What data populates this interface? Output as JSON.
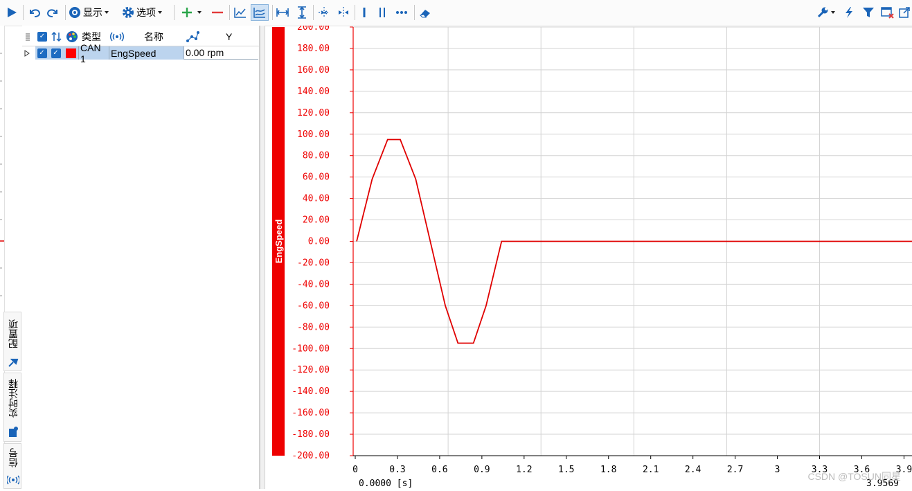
{
  "toolbar": {
    "display_label": "显示",
    "options_label": "选项"
  },
  "icons": [
    "play-icon",
    "undo-icon",
    "redo-icon",
    "display-icon",
    "gear-icon",
    "add-icon",
    "remove-icon",
    "line-chart-icon",
    "multi-line-chart-icon",
    "fit-horizontal-icon",
    "fit-vertical-icon",
    "zoom-in-icon",
    "zoom-out-icon",
    "single-cursor-icon",
    "double-cursor-icon",
    "more-cursor-icon",
    "eraser-icon",
    "wrench-icon",
    "lightning-icon",
    "filter-icon",
    "close-window-icon",
    "popout-icon"
  ],
  "side_tabs": [
    "配置项",
    "实时注释",
    "信号"
  ],
  "signal_table": {
    "columns": [
      "类型",
      "名称",
      "Y"
    ],
    "rows": [
      {
        "type": "CAN 1",
        "name": "EngSpeed",
        "value": "0.00 rpm",
        "color": "#ff0000"
      }
    ]
  },
  "chart_data": {
    "type": "line",
    "series": [
      {
        "name": "EngSpeed",
        "color": "#e00000",
        "x": [
          0.01,
          0.12,
          0.23,
          0.32,
          0.43,
          0.64,
          0.73,
          0.84,
          0.93,
          1.04,
          3.96
        ],
        "y": [
          0,
          58,
          95,
          95,
          58,
          -60,
          -95,
          -95,
          -60,
          0,
          0
        ]
      }
    ],
    "ylabel": "EngSpeed",
    "ylim": [
      -200,
      200
    ],
    "yticks": [
      "200.00",
      "180.00",
      "160.00",
      "140.00",
      "120.00",
      "100.00",
      "80.00",
      "60.00",
      "40.00",
      "20.00",
      "0.00",
      "-20.00",
      "-40.00",
      "-60.00",
      "-80.00",
      "-100.00",
      "-120.00",
      "-140.00",
      "-160.00",
      "-180.00",
      "-200.00"
    ],
    "xlim": [
      0,
      3.9569
    ],
    "xticks": [
      "0",
      "0.3",
      "0.6",
      "0.9",
      "1.2",
      "1.5",
      "1.8",
      "2.1",
      "2.4",
      "2.7",
      "3",
      "3.3",
      "3.6",
      "3.9"
    ],
    "x_start_label": "0.0000 [s]",
    "x_end_label": "3.9569",
    "grid": true,
    "axis_color": "#ee0000"
  },
  "watermark": "CSDN @TOSUN同星"
}
